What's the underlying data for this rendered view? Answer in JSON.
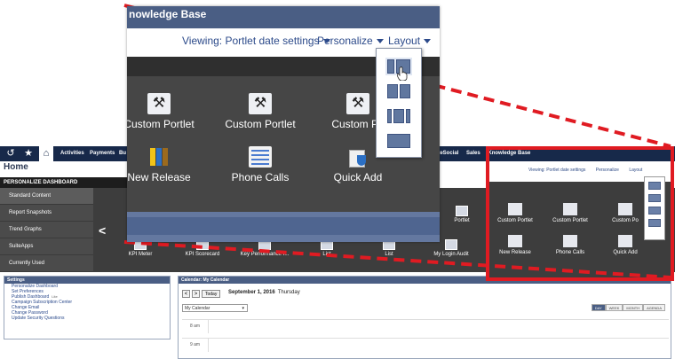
{
  "topnav": {
    "items": [
      "Activities",
      "Payments",
      "Bu"
    ],
    "portal_links": [
      "SuiteSocial",
      "Sales",
      "Knowledge Base"
    ]
  },
  "home": {
    "title": "Home",
    "personalize_bar": "PERSONALIZE DASHBOARD",
    "menu": [
      "Standard Content",
      "Report Snapshots",
      "Trend Graphs",
      "SuiteApps",
      "Currently Used"
    ],
    "strip_items": [
      "KPI Meter",
      "KPI Scorecard",
      "Key Performance I...",
      "List",
      "List",
      "My Login Audit"
    ],
    "strip_right_items": [
      "Portlet",
      "Custom Portlet",
      "Custom Portlet",
      "Custom Po"
    ]
  },
  "settings": {
    "title": "Settings",
    "links": [
      "Personalize Dashboard",
      "Set Preferences",
      "Publish Dashboard",
      "Campaign Subscription Center",
      "Change Email",
      "Change Password",
      "Update Security Questions"
    ],
    "publish_badge": "Lite"
  },
  "calendar": {
    "title": "Calendar: My Calendar",
    "prev": "<",
    "next": ">",
    "today": "Today",
    "date": "September 1, 2016",
    "dow": "Thursday",
    "selector": "My Calendar",
    "views": [
      "DAY",
      "WEEK",
      "MONTH",
      "AGENDA"
    ],
    "times": [
      "8 am",
      "9 am"
    ]
  },
  "highlight": {
    "viewing": "Viewing: Portlet date settings",
    "personalize": "Personalize",
    "layout": "Layout",
    "row1": [
      "Custom Portlet",
      "Custom Portlet",
      "Custom Po"
    ],
    "row2": [
      "New Release",
      "Phone Calls",
      "Quick Add"
    ]
  },
  "zoom": {
    "title": "nowledge Base",
    "viewing": "Viewing: Portlet date settings",
    "personalize": "Personalize",
    "layout": "Layout",
    "row1": [
      "Custom Portlet",
      "Custom Portlet",
      "Custom Po"
    ],
    "row2": [
      "New Release",
      "Phone Calls",
      "Quick Add"
    ],
    "layout_options": [
      "layout-2col-wide-left",
      "layout-2col-equal",
      "layout-3col",
      "layout-1col"
    ]
  },
  "colors": {
    "nav_dark": "#17294a",
    "header_blue": "#4a5e84",
    "highlight_red": "#e01b22",
    "panel_dark": "#464646"
  }
}
